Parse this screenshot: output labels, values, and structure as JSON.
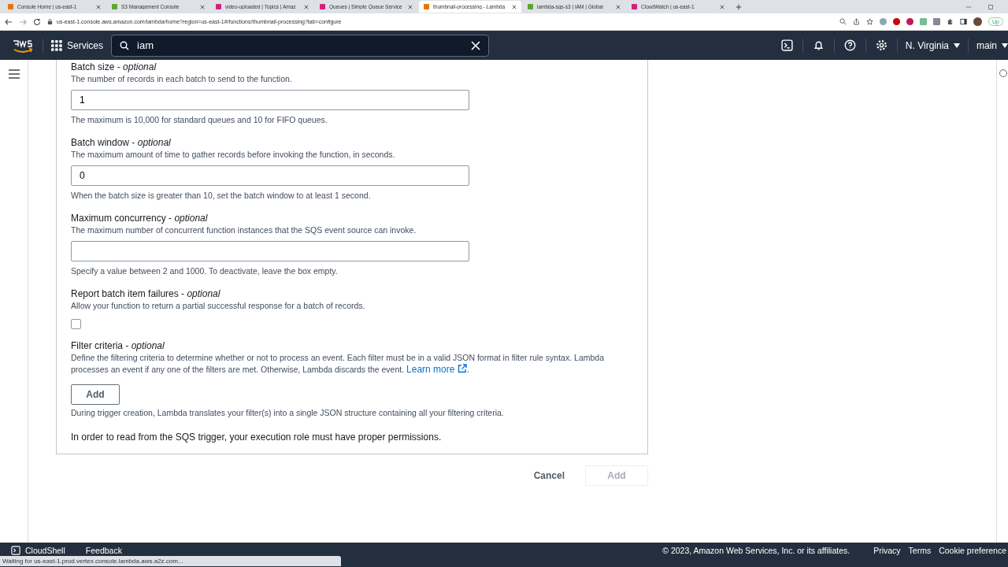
{
  "browser": {
    "tabs": [
      {
        "title": "Console Home | us-east-1",
        "color": "#e8730c",
        "selected": false
      },
      {
        "title": "S3 Management Console",
        "color": "#5aa832",
        "selected": false
      },
      {
        "title": "video-uploaded | Topics | Amaz",
        "color": "#d6217a",
        "selected": false
      },
      {
        "title": "Queues | Simple Queue Service",
        "color": "#d6217a",
        "selected": false
      },
      {
        "title": "thumbnail-processing - Lambda",
        "color": "#e8730c",
        "selected": true
      },
      {
        "title": "lambda-sqs-s3 | IAM | Global",
        "color": "#5aa832",
        "selected": false
      },
      {
        "title": "CloudWatch | us-east-1",
        "color": "#d6217a",
        "selected": false
      }
    ],
    "url": "us-east-1.console.aws.amazon.com/lambda/home?region=us-east-1#/functions/thumbnail-processing?tab=configure",
    "update_label": "Up"
  },
  "nav": {
    "services": "Services",
    "search_value": "iam",
    "region": "N. Virginia",
    "account": "main"
  },
  "form": {
    "fields": [
      {
        "kind": "input",
        "label": "Batch size - *optional*",
        "description": "The number of records in each batch to send to the function.",
        "value": "1",
        "hint": "The maximum is 10,000 for standard queues and 10 for FIFO queues."
      },
      {
        "kind": "input",
        "label": "Batch window - *optional*",
        "description": "The maximum amount of time to gather records before invoking the function, in seconds.",
        "value": "0",
        "hint": "When the batch size is greater than 10, set the batch window to at least 1 second."
      },
      {
        "kind": "input",
        "label": "Maximum concurrency - *optional*",
        "description": "The maximum number of concurrent function instances that the SQS event source can invoke.",
        "hint": "Specify a value between 2 and 1000. To deactivate, leave the box empty."
      },
      {
        "kind": "checkbox",
        "label": "Report batch item failures - *optional*",
        "description": "Allow your function to return a partial successful response for a batch of records.",
        "checked": false
      }
    ],
    "filter": {
      "label": "Filter criteria - *optional*",
      "description": "Define the filtering criteria to determine whether or not to process an event. Each filter must be in a valid JSON format in filter rule syntax. Lambda processes an event if any one of the filters are met. Otherwise, Lambda discards the event.",
      "link": "Learn more",
      "link_end": ".",
      "add_button": "Add",
      "note": "During trigger creation, Lambda translates your filter(s) into a single JSON structure containing all your filtering criteria."
    },
    "permissions_note": "In order to read from the SQS trigger, your execution role must have proper permissions."
  },
  "actions": {
    "cancel": "Cancel",
    "add": "Add",
    "add_disabled": true
  },
  "footer": {
    "cloudshell": "CloudShell",
    "feedback": "Feedback",
    "copyright": "© 2023, Amazon Web Services, Inc. or its affiliates.",
    "links": [
      "Privacy",
      "Terms",
      "Cookie preference"
    ]
  },
  "status": "Waiting for us-east-1.prod.vertex.console.lambda.aws.a2z.com..."
}
